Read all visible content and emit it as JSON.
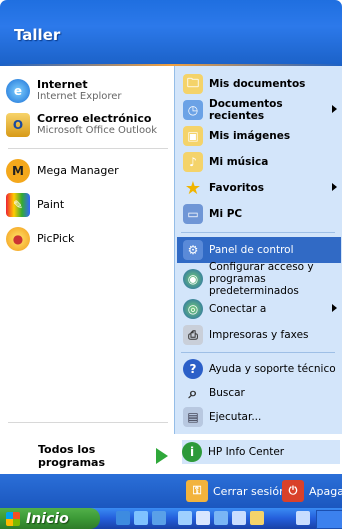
{
  "header": {
    "user": "Taller"
  },
  "left": {
    "pinned": [
      {
        "title": "Internet",
        "sub": "Internet Explorer",
        "icon": "internet-explorer-icon"
      },
      {
        "title": "Correo electrónico",
        "sub": "Microsoft Office Outlook",
        "icon": "outlook-icon"
      }
    ],
    "recent": [
      {
        "label": "Mega Manager",
        "icon": "mega-manager-icon"
      },
      {
        "label": "Paint",
        "icon": "paint-icon"
      },
      {
        "label": "PicPick",
        "icon": "picpick-icon"
      }
    ],
    "all_programs": "Todos los programas"
  },
  "right": {
    "items": [
      {
        "label": "Mis documentos",
        "bold": true,
        "icon": "folder-documents-icon"
      },
      {
        "label": "Documentos recientes",
        "bold": true,
        "arrow": true,
        "icon": "recent-documents-icon"
      },
      {
        "label": "Mis imágenes",
        "bold": true,
        "icon": "folder-pictures-icon"
      },
      {
        "label": "Mi música",
        "bold": true,
        "icon": "folder-music-icon"
      },
      {
        "label": "Favoritos",
        "bold": true,
        "arrow": true,
        "icon": "favorites-star-icon"
      },
      {
        "label": "Mi PC",
        "bold": true,
        "icon": "my-computer-icon"
      },
      {
        "label": "Panel de control",
        "highlight": true,
        "icon": "control-panel-icon"
      },
      {
        "label": "Configurar acceso y programas predeterminados",
        "icon": "default-programs-icon"
      },
      {
        "label": "Conectar a",
        "arrow": true,
        "icon": "connect-to-icon"
      },
      {
        "label": "Impresoras y faxes",
        "icon": "printers-icon"
      },
      {
        "label": "Ayuda y soporte técnico",
        "icon": "help-icon"
      },
      {
        "label": "Buscar",
        "icon": "search-icon"
      },
      {
        "label": "Ejecutar...",
        "icon": "run-icon"
      },
      {
        "label": "HP Info Center",
        "icon": "hp-info-icon"
      }
    ]
  },
  "footer": {
    "logoff": "Cerrar sesión",
    "shutdown": "Apagar"
  },
  "taskbar": {
    "start": "Inicio"
  }
}
